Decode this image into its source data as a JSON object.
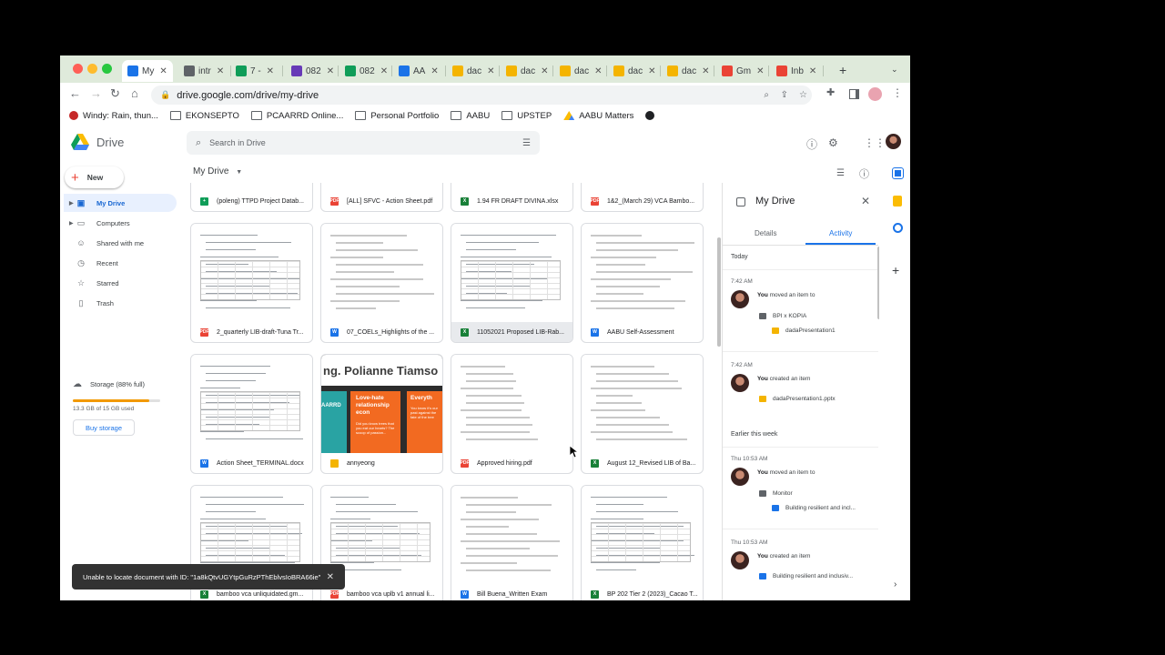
{
  "browser": {
    "tabs": [
      {
        "label": "My",
        "color": "#1a73e8"
      },
      {
        "label": "intr",
        "color": "#5f6368"
      },
      {
        "label": "7 -",
        "color": "#0f9d58"
      },
      {
        "label": "082",
        "color": "#673ab7"
      },
      {
        "label": "082",
        "color": "#0f9d58"
      },
      {
        "label": "AA",
        "color": "#1a73e8"
      },
      {
        "label": "dac",
        "color": "#f4b400"
      },
      {
        "label": "dac",
        "color": "#f4b400"
      },
      {
        "label": "dac",
        "color": "#f4b400"
      },
      {
        "label": "dac",
        "color": "#f4b400"
      },
      {
        "label": "dac",
        "color": "#f4b400"
      },
      {
        "label": "Gm",
        "color": "#ea4335"
      },
      {
        "label": "Inb",
        "color": "#ea4335"
      }
    ],
    "url": "drive.google.com/drive/my-drive",
    "bookmarks": [
      {
        "label": "Windy: Rain, thun...",
        "icon": "windy-icon"
      },
      {
        "label": "EKONSEPTO",
        "icon": "folder-icon"
      },
      {
        "label": "PCAARRD Online...",
        "icon": "folder-icon"
      },
      {
        "label": "Personal Portfolio",
        "icon": "folder-icon"
      },
      {
        "label": "AABU",
        "icon": "folder-icon"
      },
      {
        "label": "UPSTEP",
        "icon": "folder-icon"
      },
      {
        "label": "AABU Matters",
        "icon": "drive-icon"
      },
      {
        "label": "",
        "icon": "globe-icon"
      }
    ]
  },
  "drive": {
    "app_name": "Drive",
    "search_placeholder": "Search in Drive",
    "new_label": "New",
    "nav": [
      {
        "label": "My Drive",
        "icon": "my-drive-icon",
        "glyph": "▣"
      },
      {
        "label": "Computers",
        "icon": "computers-icon",
        "glyph": "▭"
      },
      {
        "label": "Shared with me",
        "icon": "shared-icon",
        "glyph": "☺"
      },
      {
        "label": "Recent",
        "icon": "recent-icon",
        "glyph": "◷"
      },
      {
        "label": "Starred",
        "icon": "star-icon",
        "glyph": "☆"
      },
      {
        "label": "Trash",
        "icon": "trash-icon",
        "glyph": "▯"
      }
    ],
    "storage": {
      "label": "Storage (88% full)",
      "used": "13.3 GB of 15 GB used",
      "percent": 88
    },
    "buy_storage": "Buy storage",
    "main_title": "My Drive",
    "files": [
      {
        "name": "(poleng) TTPD Project Datab...",
        "type": "gsh"
      },
      {
        "name": "[ALL] SFVC - Action Sheet.pdf",
        "type": "pdf"
      },
      {
        "name": "1.94 FR DRAFT DIVINA.xlsx",
        "type": "xls"
      },
      {
        "name": "1&2_(March 29) VCA Bambo...",
        "type": "pdf"
      },
      {
        "name": "2_quarterly LIB-draft-Tuna Tr...",
        "type": "pdf"
      },
      {
        "name": "07_COELs_Highlights of the ...",
        "type": "doc"
      },
      {
        "name": "11052021 Proposed LIB-Rab...",
        "type": "xls"
      },
      {
        "name": "AABU Self-Assessment",
        "type": "doc"
      },
      {
        "name": "Action Sheet_TERMINAL.docx",
        "type": "doc"
      },
      {
        "name": "annyeong",
        "type": "slides"
      },
      {
        "name": "Approved hiring.pdf",
        "type": "pdf"
      },
      {
        "name": "August 12_Revised LIB of Ba...",
        "type": "xls"
      },
      {
        "name": "bamboo vca unliquidated.gm...",
        "type": "xls"
      },
      {
        "name": "bamboo vca uplb v1 annual li...",
        "type": "pdf"
      },
      {
        "name": "Bill Buena_Written Exam",
        "type": "doc"
      },
      {
        "name": "BP 202 Tier 2 (2023)_Cacao T...",
        "type": "xls"
      }
    ],
    "slide_preview": {
      "headline": "ng. Polianne Tiamso",
      "box1_title": "Love-hate relationship econ",
      "box1_body": "Did you know trees that you eat our hearts? The scoop of passion...",
      "box2_title": "Everyth",
      "box2_body": "You know it's our past against the fate of the tree",
      "left_text": "AARRD"
    },
    "panel": {
      "title": "My Drive",
      "tabs": [
        "Details",
        "Activity"
      ],
      "active_tab": "Activity",
      "today": "Today",
      "earlier": "Earlier this week",
      "activities": [
        {
          "time": "7:42 AM",
          "actor": "You",
          "action": "moved an item to",
          "folder": "BPI x KOPIA",
          "item": "dadaPresentation1",
          "item_type": "slides"
        },
        {
          "time": "7:42 AM",
          "actor": "You",
          "action": "created an item",
          "item": "dadaPresentation1.pptx",
          "item_type": "slides"
        },
        {
          "time": "Thu 10:53 AM",
          "actor": "You",
          "action": "moved an item to",
          "folder": "Monitor",
          "item": "Building resilient and incl...",
          "item_type": "doc"
        },
        {
          "time": "Thu 10:53 AM",
          "actor": "You",
          "action": "created an item",
          "item": "Building resilient and inclusiv...",
          "item_type": "doc"
        }
      ]
    },
    "toast": {
      "message": "Unable to locate document with ID: \"1a8kQtvUGYtpGuRzPThEblvsIoBRA66ie\""
    }
  }
}
